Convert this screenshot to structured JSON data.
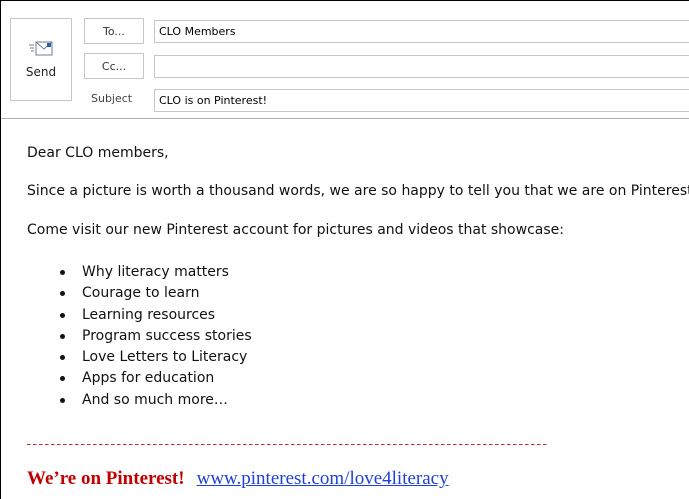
{
  "header": {
    "send_label": "Send",
    "to_button": "To...",
    "cc_button": "Cc...",
    "subject_label": "Subject",
    "to_value": "CLO Members",
    "cc_value": "",
    "subject_value": "CLO is on Pinterest!"
  },
  "message": {
    "greeting": "Dear CLO members,",
    "paragraph1": "Since a picture is worth a thousand words, we are so happy to tell you that we are on Pinterest!",
    "paragraph2": "Come visit our new Pinterest account for pictures and videos that showcase:",
    "bullets": [
      "Why literacy matters",
      "Courage to learn",
      "Learning resources",
      "Program success stories",
      "Love Letters to Literacy",
      "Apps for education",
      "And so much more…"
    ],
    "promo": "We’re on Pinterest!",
    "link": "www.pinterest.com/love4literacy"
  },
  "colors": {
    "promo": "#c00000",
    "link": "#1f3fd8",
    "divider": "#c62828"
  },
  "icons": {
    "send": "send-envelope-icon"
  }
}
